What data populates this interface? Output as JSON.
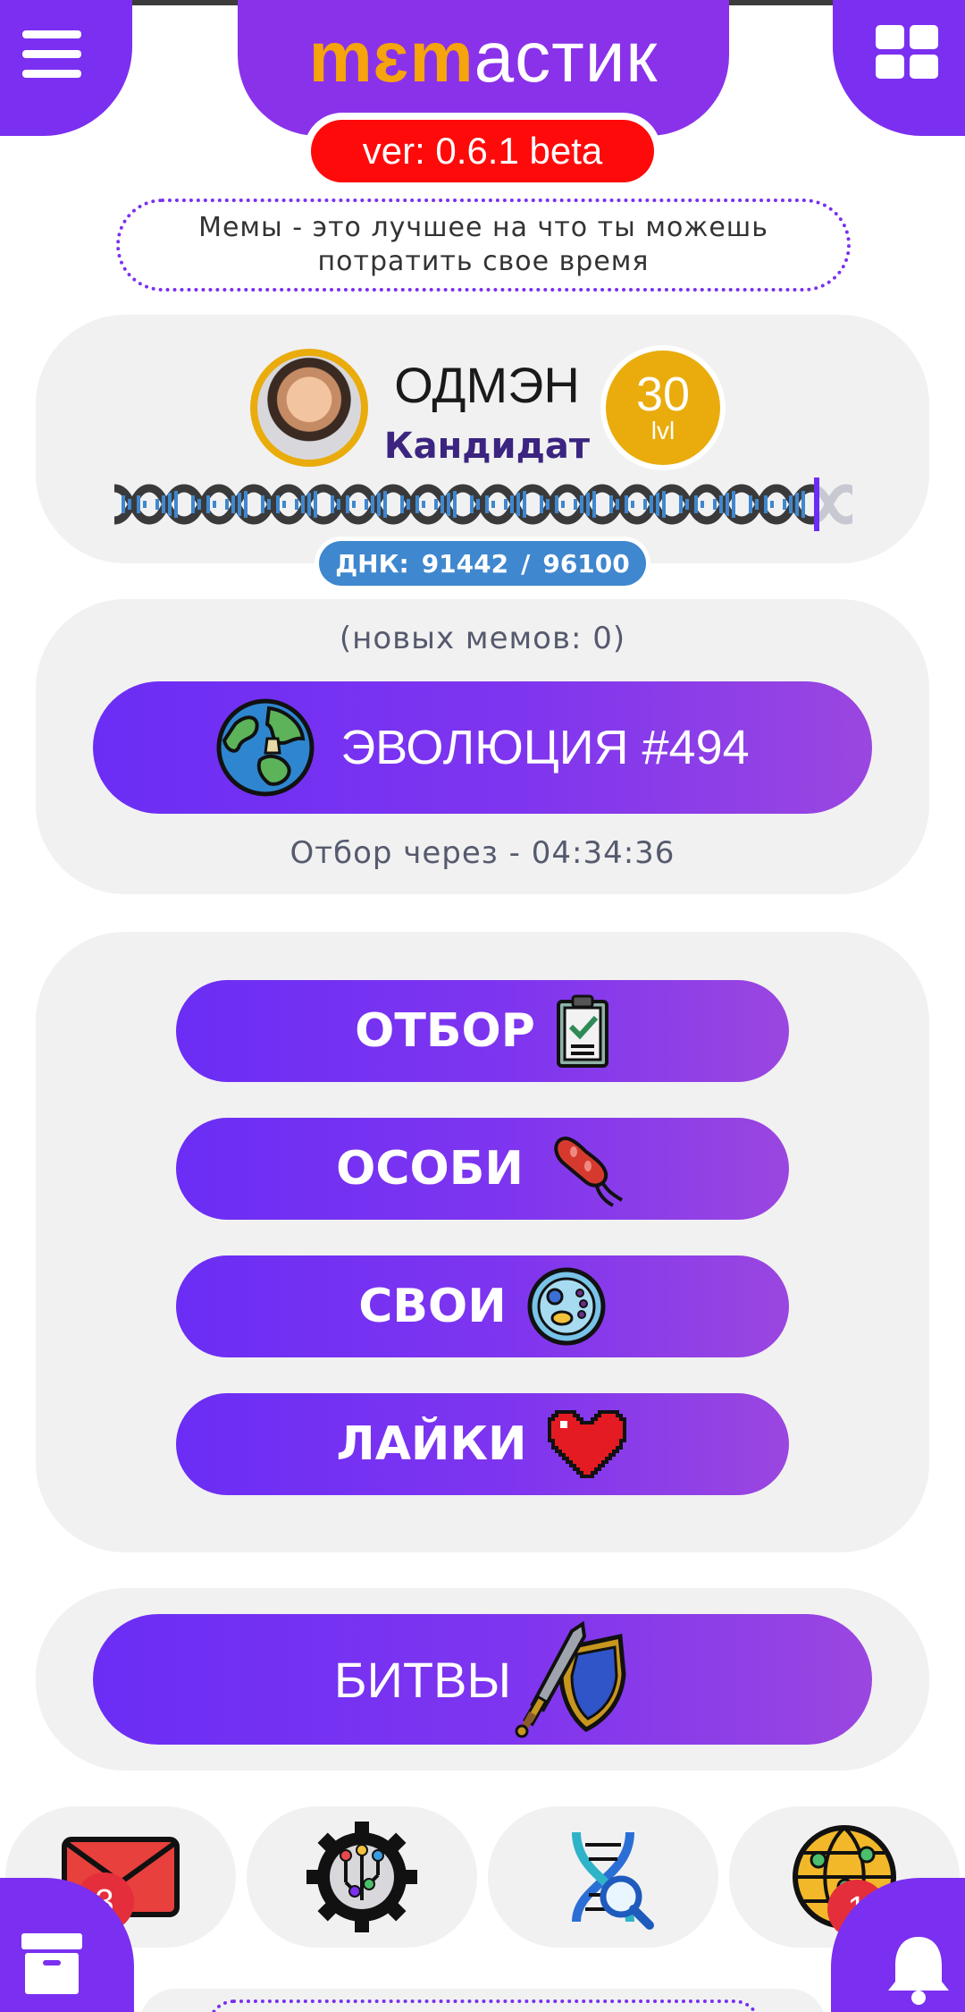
{
  "header": {
    "logo_orange": "mɛm",
    "logo_white": "астик",
    "version": "ver: 0.6.1 beta"
  },
  "slogan": "Мемы - это лучшее на что ты можешь потратить свое время",
  "profile": {
    "username": "ОДМЭН",
    "rank": "Кандидат",
    "level": "30",
    "level_unit": "lvl",
    "dna_label": "ДНК:",
    "dna_current": "91442",
    "dna_separator": "/",
    "dna_max": "96100",
    "dna_progress": 0.951
  },
  "evolution": {
    "new_memes": "(новых мемов: 0)",
    "button_label": "ЭВОЛЮЦИЯ #494",
    "countdown": "Отбор через - 04:34:36"
  },
  "menu": [
    {
      "label": "ОТБОР",
      "icon": "clipboard-check-icon"
    },
    {
      "label": "ОСОБИ",
      "icon": "bacterium-icon"
    },
    {
      "label": "СВОИ",
      "icon": "petri-dish-icon"
    },
    {
      "label": "ЛАЙКИ",
      "icon": "heart-icon"
    }
  ],
  "battles": {
    "label": "БИТВЫ",
    "icon": "sword-shield-icon"
  },
  "bottom_nav": [
    {
      "icon": "mail-icon",
      "badge": "3"
    },
    {
      "icon": "gear-circuit-icon",
      "badge": ""
    },
    {
      "icon": "dna-search-icon",
      "badge": ""
    },
    {
      "icon": "globe-network-icon",
      "badge": "1"
    }
  ],
  "colors": {
    "accent": "#7b2ff0",
    "gold": "#e9ac0c",
    "version_red": "#ff0a0a",
    "dna_blue": "#3f87ce",
    "panel": "#f1f1f1",
    "badge_red": "#e42e3b"
  }
}
